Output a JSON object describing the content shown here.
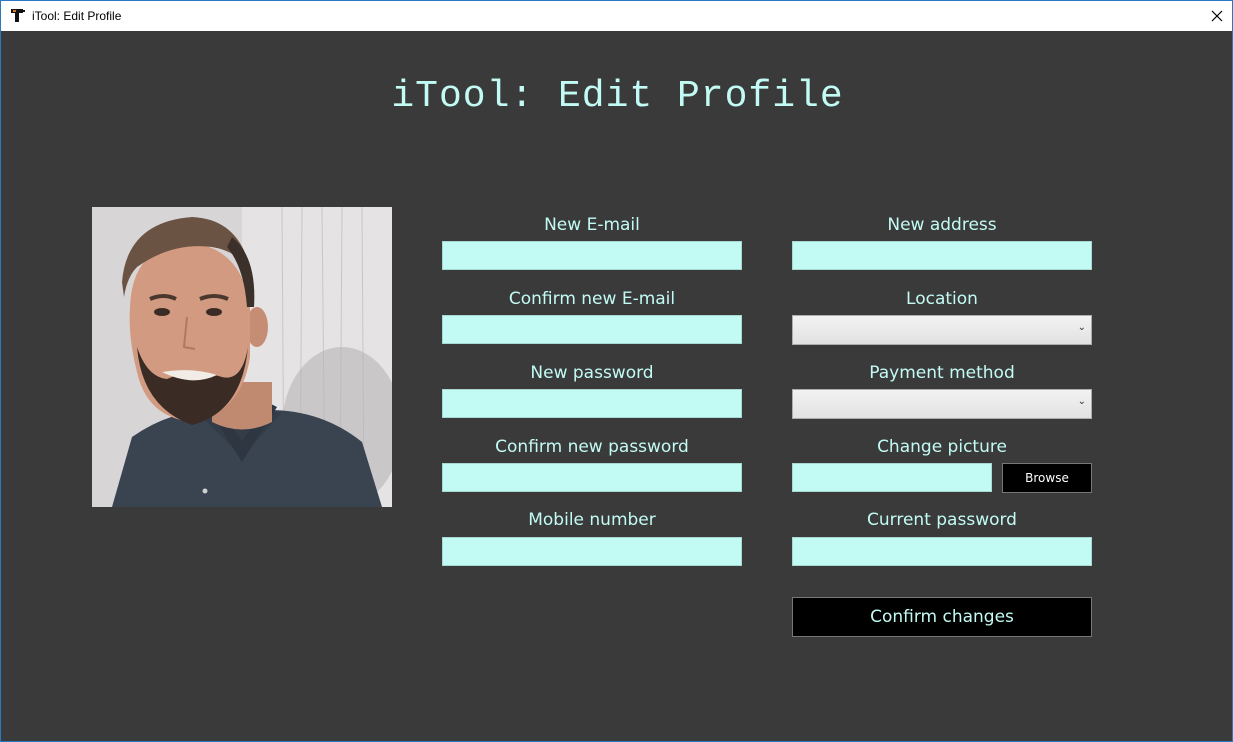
{
  "window": {
    "title": "iTool: Edit Profile"
  },
  "page": {
    "heading": "iTool: Edit Profile"
  },
  "form": {
    "left": [
      {
        "label": "New E-mail",
        "value": ""
      },
      {
        "label": "Confirm new E-mail",
        "value": ""
      },
      {
        "label": "New password",
        "value": ""
      },
      {
        "label": "Confirm new password",
        "value": ""
      },
      {
        "label": "Mobile number",
        "value": ""
      }
    ],
    "right": {
      "address": {
        "label": "New address",
        "value": ""
      },
      "location": {
        "label": "Location",
        "value": ""
      },
      "payment": {
        "label": "Payment method",
        "value": ""
      },
      "picture": {
        "label": "Change picture",
        "value": "",
        "browse_label": "Browse"
      },
      "current_password": {
        "label": "Current password",
        "value": ""
      }
    },
    "confirm_label": "Confirm changes"
  },
  "colors": {
    "background": "#3b3a3b",
    "accent": "#c2fbf4",
    "button": "#000000"
  }
}
